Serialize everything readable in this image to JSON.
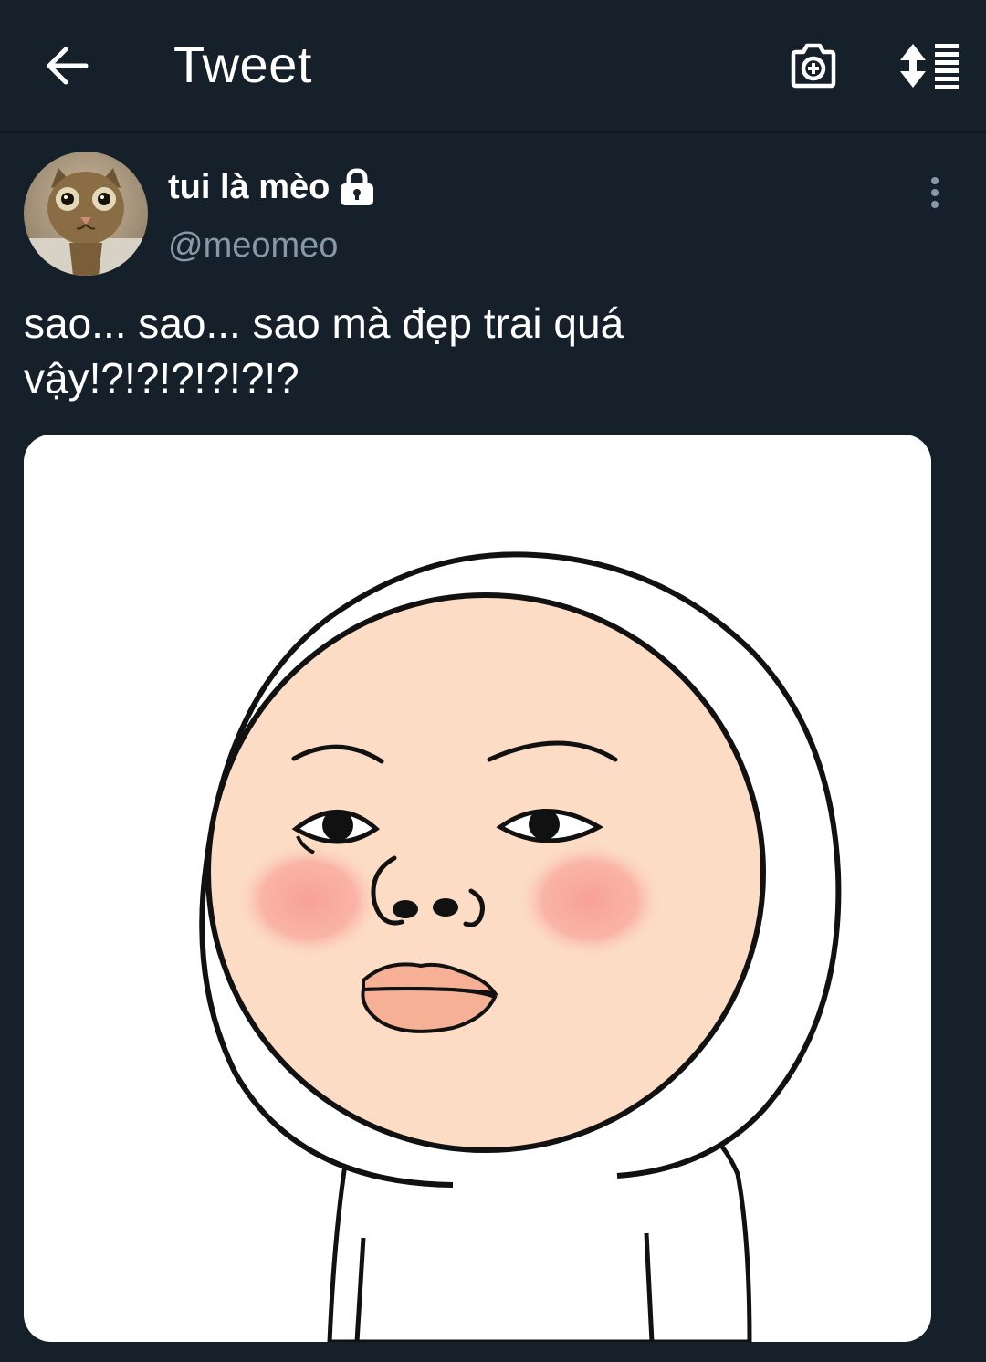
{
  "header": {
    "title": "Tweet",
    "back_icon": "arrow-left-icon",
    "camera_icon": "camera-add-icon",
    "sort_icon": "sort-list-icon"
  },
  "tweet": {
    "display_name": "tui là mèo",
    "handle": "@meomeo",
    "protected": true,
    "text": "sao... sao... sao mà đẹp trai quá\nvậy!?!?!?!?!?!?",
    "more_icon": "more-vertical-icon",
    "media": {
      "type": "image",
      "subject": "cartoon face illustration"
    }
  },
  "colors": {
    "background": "#15202b",
    "text": "#ffffff",
    "secondary_text": "#8899a6",
    "face_skin": "#fcdcc4",
    "blush": "#f89d96",
    "lips": "#f6b096"
  }
}
